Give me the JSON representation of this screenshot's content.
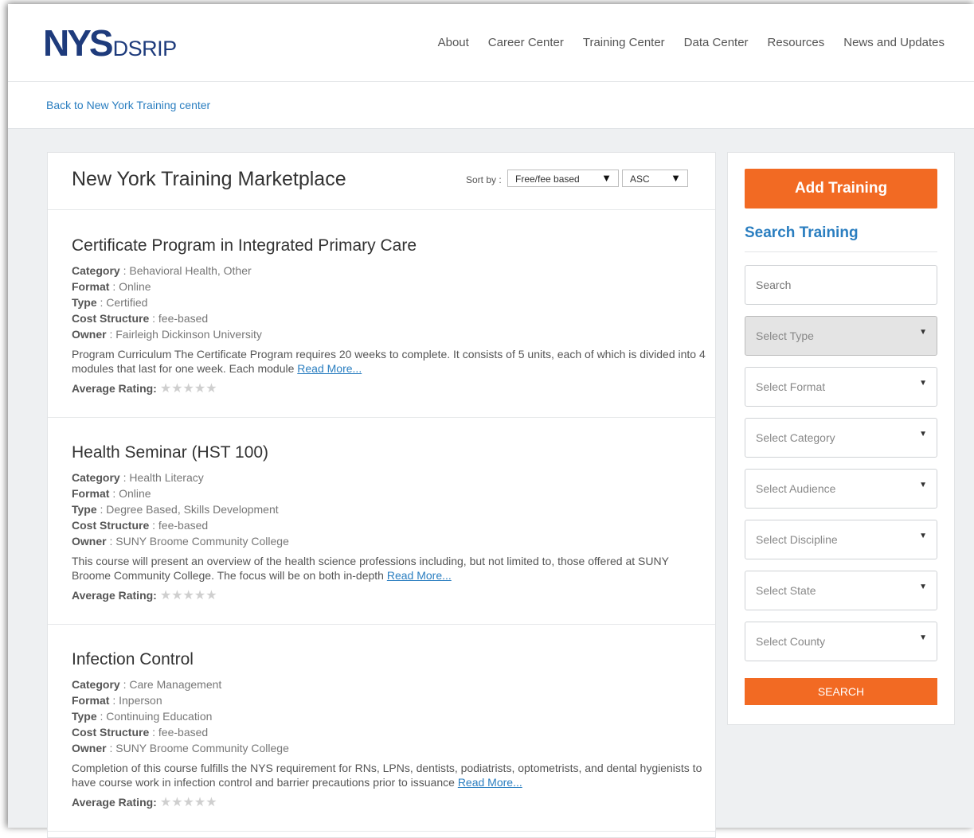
{
  "logo": {
    "primary": "NYS",
    "secondary": "DSRIP"
  },
  "nav": [
    "About",
    "Career Center",
    "Training Center",
    "Data Center",
    "Resources",
    "News and Updates"
  ],
  "breadcrumb": "Back to New York Training center",
  "main": {
    "title": "New York Training Marketplace",
    "sort_label": "Sort by :",
    "sort_field": "Free/fee based",
    "sort_order": "ASC"
  },
  "labels": {
    "category": "Category",
    "format": "Format",
    "type": "Type",
    "cost": "Cost Structure",
    "owner": "Owner",
    "rating": "Average Rating:",
    "read_more": "Read More..."
  },
  "rating_stars": "★★★★★",
  "courses": [
    {
      "title": "Certificate Program in Integrated Primary Care",
      "category": " : Behavioral Health, Other",
      "format": " : Online",
      "type": " : Certified",
      "cost": " : fee-based",
      "owner": " : Fairleigh Dickinson University",
      "description": "Program Curriculum The Certificate Program requires 20 weeks to complete. It consists of 5 units, each of which is divided into 4 modules that last for one week. Each module "
    },
    {
      "title": "Health Seminar (HST 100)",
      "category": " : Health Literacy",
      "format": " : Online",
      "type": " : Degree Based, Skills Development",
      "cost": " : fee-based",
      "owner": " : SUNY Broome Community College",
      "description": "This course will present an overview of the health science professions including, but not limited to, those offered at SUNY Broome Community College. The focus will be on both in-depth "
    },
    {
      "title": "Infection Control",
      "category": " : Care Management",
      "format": " : Inperson",
      "type": " : Continuing Education",
      "cost": " : fee-based",
      "owner": " : SUNY Broome Community College",
      "description": "Completion of this course fulfills the NYS requirement for RNs, LPNs, dentists, podiatrists, optometrists, and dental hygienists to have course work in infection control and barrier precautions prior to issuance "
    }
  ],
  "sidebar": {
    "add_button": "Add Training",
    "title": "Search Training",
    "search_placeholder": "Search",
    "selects": [
      "Select Type",
      "Select Format",
      "Select Category",
      "Select Audience",
      "Select Discipline",
      "Select State",
      "Select County"
    ],
    "search_button": "SEARCH"
  },
  "colors": {
    "brand": "#1e3b7c",
    "accent": "#f26a23",
    "link": "#2a7ec0"
  }
}
